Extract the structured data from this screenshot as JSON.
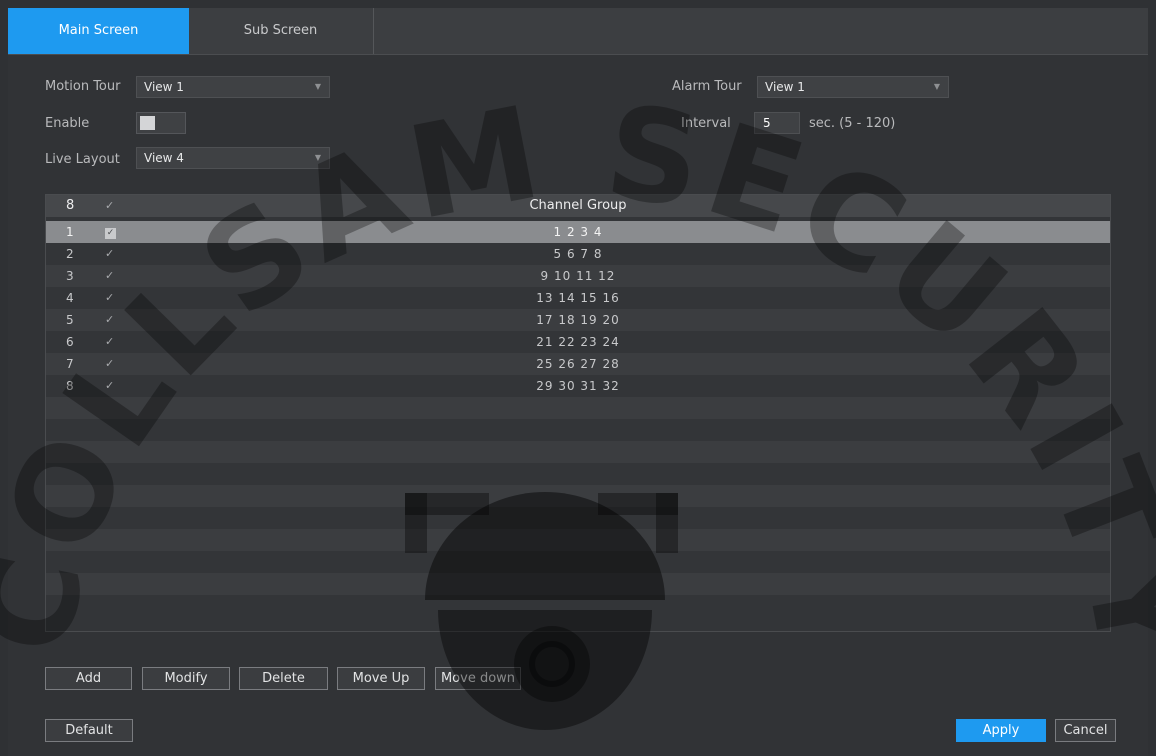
{
  "tabs": {
    "main_screen": "Main Screen",
    "sub_screen": "Sub Screen"
  },
  "form": {
    "motion_tour_label": "Motion Tour",
    "motion_tour_value": "View 1",
    "enable_label": "Enable",
    "enable_on": true,
    "live_layout_label": "Live Layout",
    "live_layout_value": "View 4",
    "alarm_tour_label": "Alarm Tour",
    "alarm_tour_value": "View 1",
    "interval_label": "Interval",
    "interval_value": "5",
    "interval_unit": "sec.  (5 - 120)"
  },
  "table": {
    "header_num": "8",
    "header_check": "✓",
    "header_group": "Channel Group",
    "rows": [
      {
        "num": "1",
        "check": "✓",
        "group": "1 2 3 4",
        "selected": true
      },
      {
        "num": "2",
        "check": "✓",
        "group": "5 6 7 8"
      },
      {
        "num": "3",
        "check": "✓",
        "group": "9 10 11 12"
      },
      {
        "num": "4",
        "check": "✓",
        "group": "13 14 15 16"
      },
      {
        "num": "5",
        "check": "✓",
        "group": "17 18 19 20"
      },
      {
        "num": "6",
        "check": "✓",
        "group": "21 22 23 24"
      },
      {
        "num": "7",
        "check": "✓",
        "group": "25 26 27 28"
      },
      {
        "num": "8",
        "check": "✓",
        "group": "29 30 31 32"
      }
    ]
  },
  "buttons": {
    "add": "Add",
    "modify": "Modify",
    "delete": "Delete",
    "move_up": "Move Up",
    "move_down": "Move down",
    "default": "Default",
    "apply": "Apply",
    "cancel": "Cancel"
  },
  "watermark": {
    "text": "COLLSAM SECURITY"
  },
  "colors": {
    "accent": "#1e9af0",
    "background": "#313336",
    "selected_row": "#8a8c8f"
  }
}
